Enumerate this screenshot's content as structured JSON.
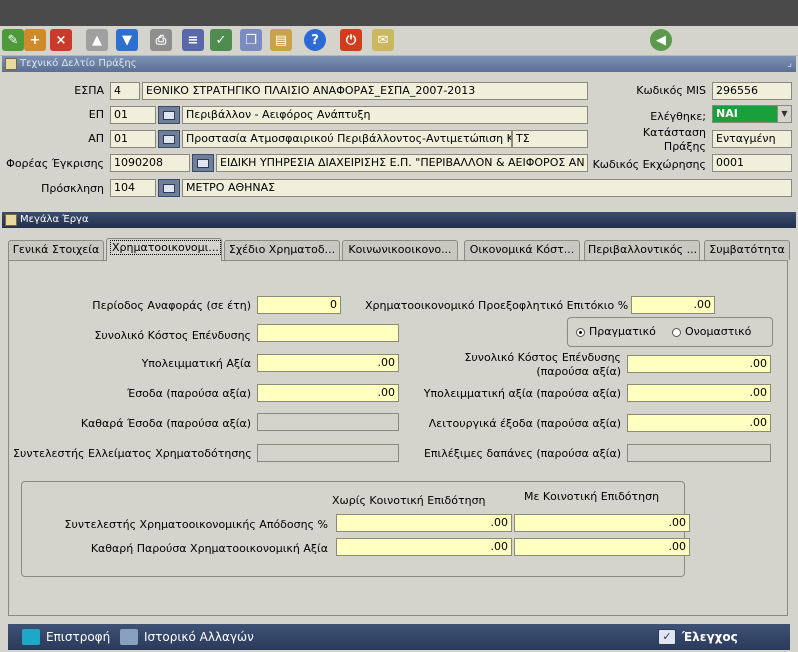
{
  "header_panel": {
    "title": "Τεχνικό Δελτίο Πράξης",
    "espa": {
      "label": "ΕΣΠΑ",
      "code": "4",
      "value": "ΕΘΝΙΚΟ ΣΤΡΑΤΗΓΙΚΟ ΠΛΑΙΣΙΟ ΑΝΑΦΟΡΑΣ_ΕΣΠΑ_2007-2013"
    },
    "ep": {
      "label": "ΕΠ",
      "code": "01",
      "value": "Περιβάλλον - Αειφόρος Ανάπτυξη"
    },
    "ap": {
      "label": "ΑΠ",
      "code": "01",
      "value": "Προστασία Ατμοσφαιρικού Περιβάλλοντος-Αντιμετώπιση Κλιμ",
      "extra": "ΤΣ"
    },
    "foreas": {
      "label": "Φορέας Έγκρισης",
      "code": "1090208",
      "value": "ΕΙΔΙΚΗ ΥΠΗΡΕΣΙΑ ΔΙΑΧΕΙΡΙΣΗΣ Ε.Π. \"ΠΕΡΙΒΑΛΛΟΝ & ΑΕΙΦΟΡΟΣ ΑΝ"
    },
    "prosklisi": {
      "label": "Πρόσκληση",
      "code": "104",
      "value": "ΜΕΤΡΟ ΑΘΗΝΑΣ"
    },
    "mis": {
      "label": "Κωδικός MIS",
      "value": "296556"
    },
    "elegxthike": {
      "label": "Ελέγθηκε;",
      "value": "ΝΑΙ"
    },
    "katastasi": {
      "label_1": "Κατάσταση",
      "label_2": "Πράξης",
      "value": "Ενταγμένη"
    },
    "kodikos_ekx": {
      "label": "Κωδικός Εκχώρησης",
      "value": "0001"
    }
  },
  "main_panel": {
    "title": "Μεγάλα Έργα",
    "tabs": [
      {
        "label": "Γενικά Στοιχεία"
      },
      {
        "label": "Χρηματοοικονομι..."
      },
      {
        "label": "Σχέδιο Χρηματοδ..."
      },
      {
        "label": "Κοινωνικοοικονο..."
      },
      {
        "label": "Οικονομικά Κόστ..."
      },
      {
        "label": "Περιβαλλοντικός ..."
      },
      {
        "label": "Συμβατότητα"
      }
    ],
    "left_fields": [
      {
        "label": "Περίοδος Αναφοράς (σε έτη)",
        "value": "0"
      },
      {
        "label": "Συνολικό Κόστος Επένδυσης",
        "value": ""
      },
      {
        "label": "Υπολειμματική Αξία",
        "value": ".00"
      },
      {
        "label": "Έσοδα (παρούσα αξία)",
        "value": ".00"
      },
      {
        "label": "Καθαρά Έσοδα (παρούσα αξία)",
        "value": ""
      },
      {
        "label": "Συντελεστής Ελλείματος Χρηματοδότησης",
        "value": ""
      }
    ],
    "discount_rate": {
      "label": "Χρηματοοικονομικό Προεξοφλητικό Επιτόκιο %",
      "value": ".00"
    },
    "radio": {
      "real": "Πραγματικό",
      "nominal": "Ονομαστικό"
    },
    "right_fields": {
      "total_cost_1": "Συνολικό Κόστος Επένδυσης",
      "total_cost_2": "(παρούσα αξία)",
      "total_cost_value": ".00",
      "residual_label": "Υπολειμματική αξία (παρούσα αξία)",
      "residual_value": ".00",
      "operating_label": "Λειτουργικά έξοδα (παρούσα αξία)",
      "operating_value": ".00",
      "eligible_label": "Επιλέξιμες δαπάνες (παρούσα αξία)",
      "eligible_value": ""
    },
    "grid": {
      "col_without": "Χωρίς Κοινοτική Επιδότηση",
      "col_with": "Με Κοινοτική Επιδότηση",
      "rows": [
        {
          "label": "Συντελεστής Χρηματοοικονομικής Απόδοσης %",
          "without": ".00",
          "with": ".00"
        },
        {
          "label": "Καθαρή Παρούσα Χρηματοοικονομική Αξία",
          "without": ".00",
          "with": ".00"
        }
      ]
    }
  },
  "bottom_bar": {
    "back": "Επιστροφή",
    "history": "Ιστορικό Αλλαγών",
    "check": "Έλεγχος"
  }
}
